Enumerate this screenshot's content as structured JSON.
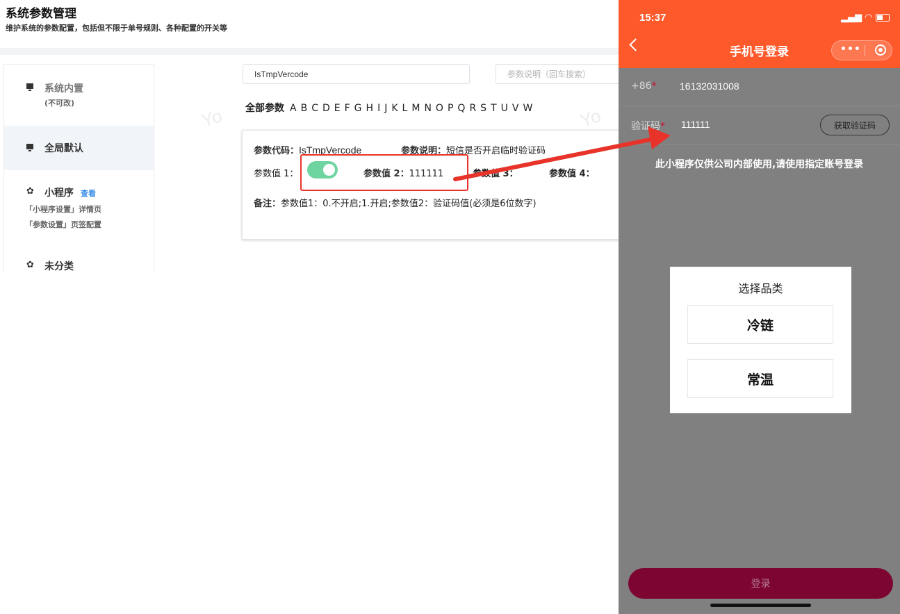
{
  "admin": {
    "title": "系统参数管理",
    "subtitle": "维护系统的参数配置，包括但不限于单号规则、各种配置的开关等",
    "sidebar": {
      "items": [
        {
          "label": "系统内置",
          "sub": "(不可改)",
          "icon": "monitor-icon",
          "active": false
        },
        {
          "label": "全局默认",
          "icon": "monitor-icon",
          "active": true
        },
        {
          "label": "小程序",
          "link": "查看",
          "sub1": "「小程序设置」详情页",
          "sub2": "「参数设置」页签配置",
          "icon": "gear-icon"
        },
        {
          "label": "未分类",
          "icon": "gear-icon"
        }
      ]
    },
    "search": {
      "code_value": "IsTmpVercode",
      "desc_placeholder": "参数说明（回车搜索）"
    },
    "alphabet": {
      "all_label": "全部参数",
      "letters": [
        "A",
        "B",
        "C",
        "D",
        "E",
        "F",
        "G",
        "H",
        "I",
        "J",
        "K",
        "L",
        "M",
        "N",
        "O",
        "P",
        "Q",
        "R",
        "S",
        "T",
        "U",
        "V",
        "W"
      ]
    },
    "watermark": "Yo",
    "card": {
      "code_label": "参数代码：",
      "code_value": "IsTmpVercode",
      "desc_label": "参数说明：",
      "desc_value": "短信是否开启临时验证码",
      "v1_label": "参数值 1：",
      "v1_on": true,
      "v2_label": "参数值 2：",
      "v2_value": "111111",
      "v3_label": "参数值 3：",
      "v4_label": "参数值 4：",
      "remark_label": "备注：",
      "remark_value": "参数值1：0.不开启;1.开启;参数值2：验证码值(必须是6位数字)"
    }
  },
  "phone": {
    "time": "15:37",
    "title": "手机号登录",
    "capsule_dots": "•••",
    "phone_prefix": "+86",
    "phone_value": "16132031008",
    "code_label": "验证码",
    "code_value": "111111",
    "get_code_button": "获取验证码",
    "notice": "此小程序仅供公司内部使用,请使用指定账号登录",
    "modal": {
      "title": "选择品类",
      "options": [
        "冷链",
        "常温"
      ]
    },
    "login_button": "登录"
  },
  "colors": {
    "header_orange": "#fd592b",
    "toggle_green": "#6fd5a0",
    "annotation_red": "#e8332a",
    "login_maroon": "#7d0532",
    "link_blue": "#3a8ee6"
  }
}
